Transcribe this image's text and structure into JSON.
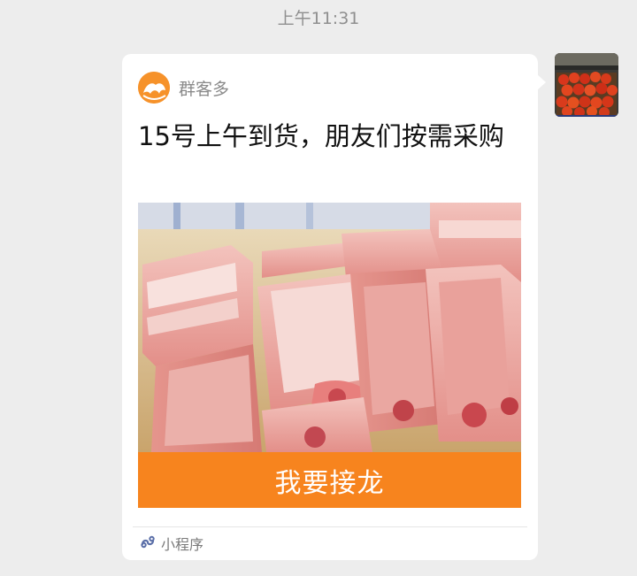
{
  "status": {
    "time": "上午11:31"
  },
  "message": {
    "source_app_name": "群客多",
    "title": "15号上午到货，朋友们按需采购",
    "cta_label": "我要接龙",
    "footer_label": "小程序",
    "image_subject": "pork-ribs"
  },
  "colors": {
    "chat_background": "#ededed",
    "bubble": "#ffffff",
    "cta_accent": "#f7841e",
    "brand_logo": "#f6922a",
    "mini_program_icon": "#5b6fa8"
  },
  "icons": {
    "source": "qunkeduo-logo-icon",
    "footer": "mini-program-icon"
  }
}
